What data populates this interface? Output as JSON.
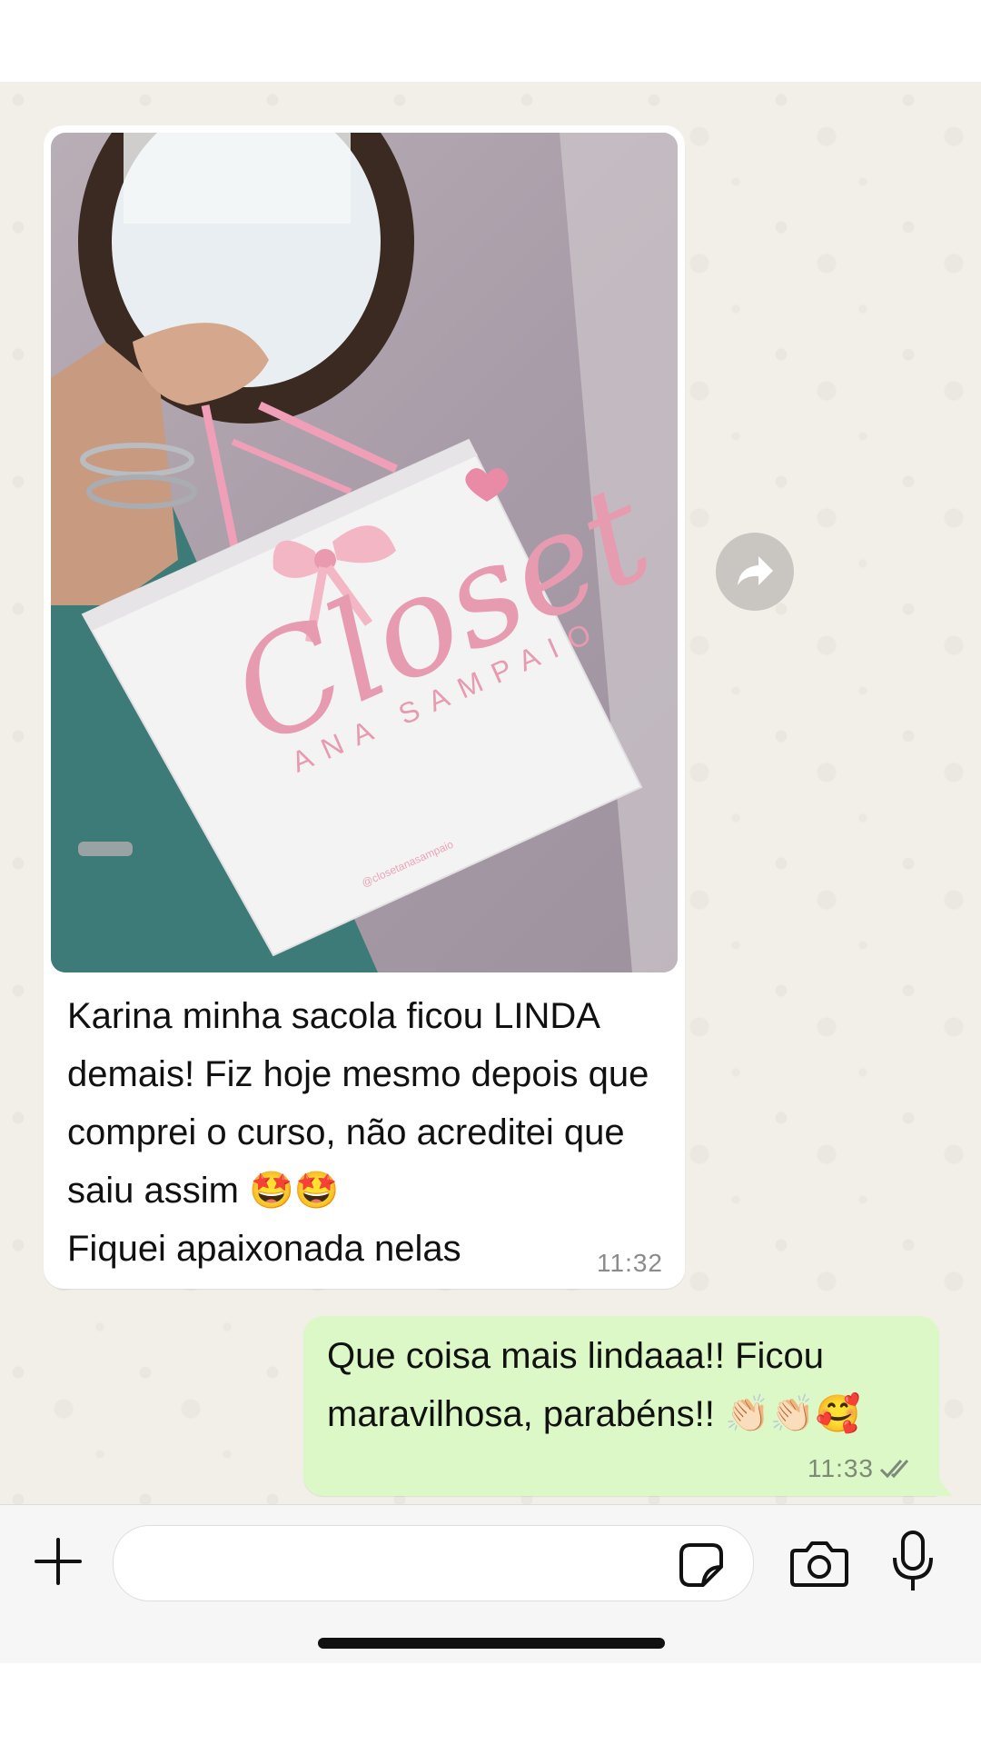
{
  "conversation": {
    "incoming": {
      "image": {
        "bag_brand": "Closet",
        "bag_subtitle": "ANA SAMPAIO",
        "bag_handle_text": "@closetanasampaio"
      },
      "text": "Karina minha sacola ficou LINDA demais! Fiz hoje mesmo depois que comprei o curso, não acreditei que saiu assim 🤩🤩\nFiquei apaixonada nelas",
      "time": "11:32"
    },
    "outgoing": {
      "text": "Que coisa mais lindaaa!! Ficou maravilhosa, parabéns!! 👏🏻👏🏻🥰",
      "time": "11:33",
      "status_icon": "double-check-icon"
    }
  },
  "input_bar": {
    "placeholder": "",
    "icons": [
      "plus-icon",
      "sticker-icon",
      "camera-icon",
      "microphone-icon"
    ]
  },
  "colors": {
    "chat_bg": "#f2efe8",
    "incoming_bubble": "#ffffff",
    "outgoing_bubble": "#dcf8c6",
    "bag_pink": "#e79bb0"
  }
}
